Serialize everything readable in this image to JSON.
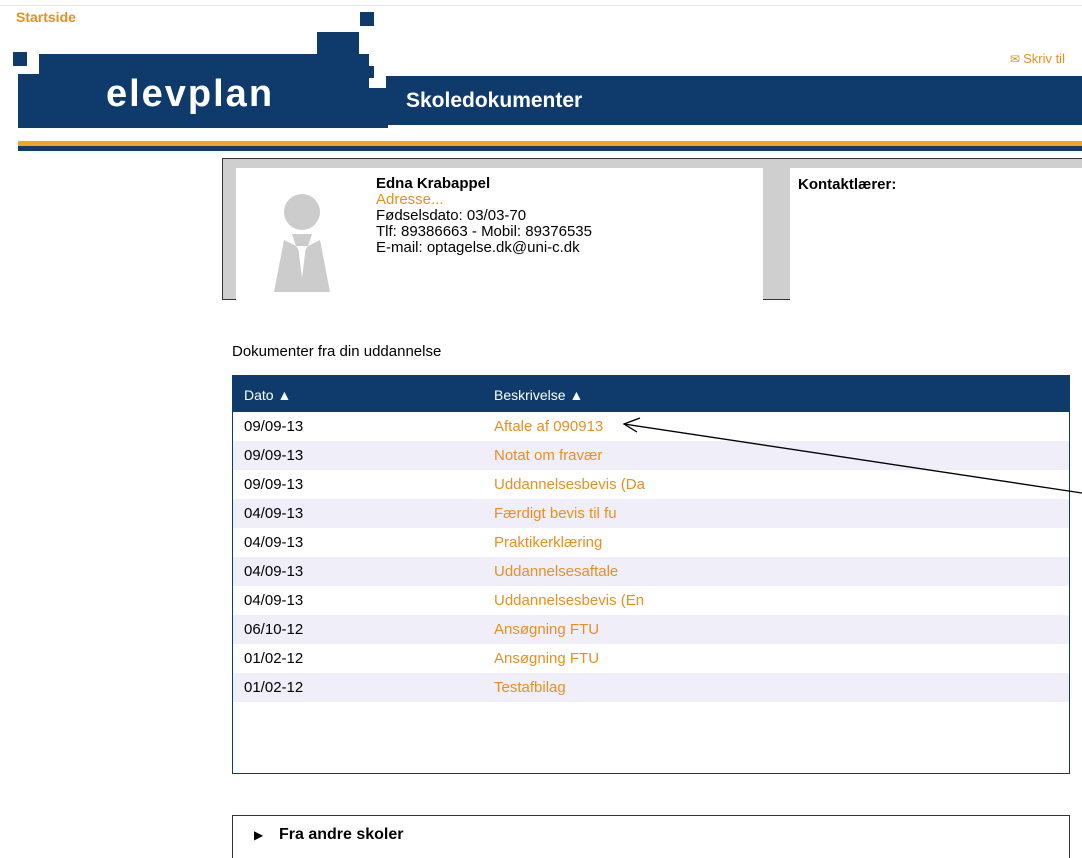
{
  "nav": {
    "startside": "Startside"
  },
  "brand": {
    "logo_text": "elevplan"
  },
  "header": {
    "title": "Skoledokumenter",
    "skriv_label": "Skriv til",
    "skriv_icon": "envelope-icon"
  },
  "colors": {
    "accent": "#e8901f",
    "navy": "#0e3b6b",
    "row_alt": "#f0eef9"
  },
  "profile": {
    "name": "Edna Krabappel",
    "address_link": "Adresse...",
    "birthdate": "Fødselsdato: 03/03-70",
    "phone": "Tlf: 89386663 - Mobil: 89376535",
    "email": "E-mail: optagelse.dk@uni-c.dk",
    "contact_label": "Kontaktlærer:"
  },
  "documents": {
    "heading": "Dokumenter fra din uddannelse",
    "columns": [
      "Dato ▲",
      "Beskrivelse ▲"
    ],
    "rows": [
      {
        "date": "09/09-13",
        "desc": "Aftale af 090913"
      },
      {
        "date": "09/09-13",
        "desc": "Notat om fravær"
      },
      {
        "date": "09/09-13",
        "desc": "Uddannelsesbevis (Da"
      },
      {
        "date": "04/09-13",
        "desc": "Færdigt bevis til fu"
      },
      {
        "date": "04/09-13",
        "desc": "Praktikerklæring"
      },
      {
        "date": "04/09-13",
        "desc": "Uddannelsesaftale"
      },
      {
        "date": "04/09-13",
        "desc": "Uddannelsesbevis (En"
      },
      {
        "date": "06/10-12",
        "desc": "Ansøgning FTU"
      },
      {
        "date": "01/02-12",
        "desc": "Ansøgning FTU"
      },
      {
        "date": "01/02-12",
        "desc": "Testafbilag"
      }
    ]
  },
  "other_schools": {
    "label": "Fra andre skoler"
  }
}
